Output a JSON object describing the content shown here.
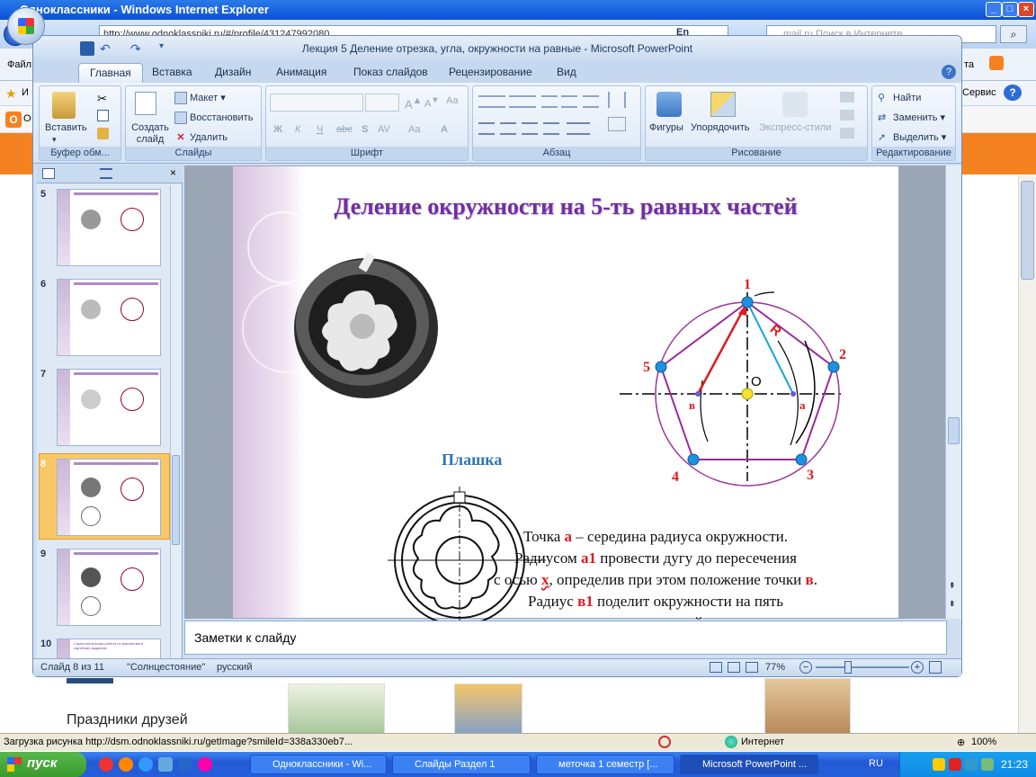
{
  "ie": {
    "title": "Одноклассники - Windows Internet Explorer",
    "address": "http://www.odnoklassniki.ru/#/profile/431247992080",
    "lang": "En",
    "search_placeholder": "mail.ru Поиск в Интернете",
    "menu_left": "Файл",
    "menu_right_1": "та",
    "menu_right_2": "Сервис",
    "links_left": "И",
    "links_ok": "О",
    "status_text": "Загрузка рисунка http://dsm.odnoklassniki.ru/getImage?smileId=338a330eb7...",
    "zone": "Интернет",
    "zoom": "100%"
  },
  "page": {
    "friends_holidays": "Праздники друзей"
  },
  "ppt": {
    "title": "Лекция 5 Деление отрезка, угла, окружности на равные - Microsoft PowerPoint",
    "tabs": [
      "Главная",
      "Вставка",
      "Дизайн",
      "Анимация",
      "Показ слайдов",
      "Рецензирование",
      "Вид"
    ],
    "groups": {
      "clipboard": "Буфер обм...",
      "slides": "Слайды",
      "font": "Шрифт",
      "paragraph": "Абзац",
      "drawing": "Рисование",
      "editing": "Редактирование"
    },
    "buttons": {
      "paste": "Вставить",
      "create_slide": "Создать слайд",
      "layout": "Макет",
      "reset": "Восстановить",
      "delete": "Удалить",
      "shapes": "Фигуры",
      "arrange": "Упорядочить",
      "quick_styles": "Экспресс-стили",
      "find": "Найти",
      "replace": "Заменить",
      "select": "Выделить"
    },
    "font_buttons": [
      "Ж",
      "К",
      "Ч",
      "abc",
      "S",
      "AV",
      "Aa",
      "A"
    ],
    "thumbnails": [
      {
        "num": "5"
      },
      {
        "num": "6"
      },
      {
        "num": "7"
      },
      {
        "num": "8"
      },
      {
        "num": "9"
      },
      {
        "num": "10"
      }
    ],
    "thumb10_text": "Самостоятельная работа по вариантам в карточках-заданиях",
    "notes_placeholder": "Заметки к слайду",
    "status": {
      "slide_of": "Слайд 8 из 11",
      "theme": "\"Солнцестояние\"",
      "language": "русский",
      "zoom": "77%"
    }
  },
  "slide": {
    "title": "Деление окружности на 5-ть равных частей",
    "caption": "Плашка",
    "labels": {
      "p1": "1",
      "p2": "2",
      "p3": "3",
      "p4": "4",
      "p5": "5",
      "o": "O",
      "a": "а",
      "b": "в",
      "r": "R"
    },
    "text": {
      "l1a": "Точка ",
      "l1b": "а",
      "l1c": " – середина радиуса окружности.",
      "l2a": "Радиусом ",
      "l2b": "а1",
      "l2c": " провести дугу до пересечения",
      "l3a": "с осью ",
      "l3b": "х",
      "l3c": ", определив при этом положение точки ",
      "l3d": "в",
      "l3e": ".",
      "l4a": "Радиус ",
      "l4b": "в1",
      "l4c": " поделит окружности на пять",
      "l5": "равных частей"
    }
  },
  "taskbar": {
    "start": "пуск",
    "tasks": [
      "Одноклассники - Wi...",
      "Слайды Раздел 1",
      "меточка 1 семестр [...",
      "Microsoft PowerPoint ..."
    ],
    "lang": "RU",
    "time": "21:23"
  }
}
